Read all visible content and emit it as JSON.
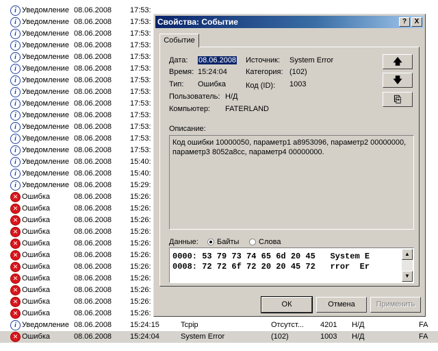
{
  "event_list": {
    "rows": [
      {
        "type": "Уведомление",
        "date": "08.06.2008",
        "time": "17:53:",
        "icon": "info-icon",
        "src": "",
        "cat": "",
        "evt": "",
        "usr": "",
        "comp": ""
      },
      {
        "type": "Уведомление",
        "date": "08.06.2008",
        "time": "17:53:",
        "icon": "info-icon",
        "src": "",
        "cat": "",
        "evt": "",
        "usr": "",
        "comp": ""
      },
      {
        "type": "Уведомление",
        "date": "08.06.2008",
        "time": "17:53:",
        "icon": "info-icon",
        "src": "",
        "cat": "",
        "evt": "",
        "usr": "",
        "comp": ""
      },
      {
        "type": "Уведомление",
        "date": "08.06.2008",
        "time": "17:53:",
        "icon": "info-icon",
        "src": "",
        "cat": "",
        "evt": "",
        "usr": "",
        "comp": ""
      },
      {
        "type": "Уведомление",
        "date": "08.06.2008",
        "time": "17:53:",
        "icon": "info-icon",
        "src": "",
        "cat": "",
        "evt": "",
        "usr": "",
        "comp": ""
      },
      {
        "type": "Уведомление",
        "date": "08.06.2008",
        "time": "17:53:",
        "icon": "info-icon",
        "src": "",
        "cat": "",
        "evt": "",
        "usr": "",
        "comp": ""
      },
      {
        "type": "Уведомление",
        "date": "08.06.2008",
        "time": "17:53:",
        "icon": "info-icon",
        "src": "",
        "cat": "",
        "evt": "",
        "usr": "",
        "comp": ""
      },
      {
        "type": "Уведомление",
        "date": "08.06.2008",
        "time": "17:53:",
        "icon": "info-icon",
        "src": "",
        "cat": "",
        "evt": "",
        "usr": "",
        "comp": ""
      },
      {
        "type": "Уведомление",
        "date": "08.06.2008",
        "time": "17:53:",
        "icon": "info-icon",
        "src": "",
        "cat": "",
        "evt": "",
        "usr": "",
        "comp": ""
      },
      {
        "type": "Уведомление",
        "date": "08.06.2008",
        "time": "17:53:",
        "icon": "info-icon",
        "src": "",
        "cat": "",
        "evt": "",
        "usr": "",
        "comp": ""
      },
      {
        "type": "Уведомление",
        "date": "08.06.2008",
        "time": "17:53:",
        "icon": "info-icon",
        "src": "",
        "cat": "",
        "evt": "",
        "usr": "",
        "comp": ""
      },
      {
        "type": "Уведомление",
        "date": "08.06.2008",
        "time": "17:53:",
        "icon": "info-icon",
        "src": "",
        "cat": "",
        "evt": "",
        "usr": "",
        "comp": ""
      },
      {
        "type": "Уведомление",
        "date": "08.06.2008",
        "time": "17:53:",
        "icon": "info-icon",
        "src": "",
        "cat": "",
        "evt": "",
        "usr": "",
        "comp": ""
      },
      {
        "type": "Уведомление",
        "date": "08.06.2008",
        "time": "15:40:",
        "icon": "info-icon",
        "src": "",
        "cat": "",
        "evt": "",
        "usr": "",
        "comp": ""
      },
      {
        "type": "Уведомление",
        "date": "08.06.2008",
        "time": "15:40:",
        "icon": "info-icon",
        "src": "",
        "cat": "",
        "evt": "",
        "usr": "",
        "comp": ""
      },
      {
        "type": "Уведомление",
        "date": "08.06.2008",
        "time": "15:29:",
        "icon": "info-icon",
        "src": "",
        "cat": "",
        "evt": "",
        "usr": "",
        "comp": ""
      },
      {
        "type": "Ошибка",
        "date": "08.06.2008",
        "time": "15:26:",
        "icon": "error-icon",
        "src": "",
        "cat": "",
        "evt": "",
        "usr": "",
        "comp": ""
      },
      {
        "type": "Ошибка",
        "date": "08.06.2008",
        "time": "15:26:",
        "icon": "error-icon",
        "src": "",
        "cat": "",
        "evt": "",
        "usr": "",
        "comp": ""
      },
      {
        "type": "Ошибка",
        "date": "08.06.2008",
        "time": "15:26:",
        "icon": "error-icon",
        "src": "",
        "cat": "",
        "evt": "",
        "usr": "",
        "comp": ""
      },
      {
        "type": "Ошибка",
        "date": "08.06.2008",
        "time": "15:26:",
        "icon": "error-icon",
        "src": "",
        "cat": "",
        "evt": "",
        "usr": "",
        "comp": ""
      },
      {
        "type": "Ошибка",
        "date": "08.06.2008",
        "time": "15:26:",
        "icon": "error-icon",
        "src": "",
        "cat": "",
        "evt": "",
        "usr": "",
        "comp": ""
      },
      {
        "type": "Ошибка",
        "date": "08.06.2008",
        "time": "15:26:",
        "icon": "error-icon",
        "src": "",
        "cat": "",
        "evt": "",
        "usr": "",
        "comp": ""
      },
      {
        "type": "Ошибка",
        "date": "08.06.2008",
        "time": "15:26:",
        "icon": "error-icon",
        "src": "",
        "cat": "",
        "evt": "",
        "usr": "",
        "comp": ""
      },
      {
        "type": "Ошибка",
        "date": "08.06.2008",
        "time": "15:26:",
        "icon": "error-icon",
        "src": "",
        "cat": "",
        "evt": "",
        "usr": "",
        "comp": ""
      },
      {
        "type": "Ошибка",
        "date": "08.06.2008",
        "time": "15:26:",
        "icon": "error-icon",
        "src": "",
        "cat": "",
        "evt": "",
        "usr": "",
        "comp": ""
      },
      {
        "type": "Ошибка",
        "date": "08.06.2008",
        "time": "15:26:",
        "icon": "error-icon",
        "src": "",
        "cat": "",
        "evt": "",
        "usr": "",
        "comp": ""
      },
      {
        "type": "Ошибка",
        "date": "08.06.2008",
        "time": "15:26:",
        "icon": "error-icon",
        "src": "",
        "cat": "",
        "evt": "",
        "usr": "",
        "comp": ""
      },
      {
        "type": "Уведомление",
        "date": "08.06.2008",
        "time": "15:24:15",
        "icon": "info-icon",
        "src": "Tcpip",
        "cat": "Отсутст...",
        "evt": "4201",
        "usr": "Н/Д",
        "comp": "FA"
      },
      {
        "type": "Ошибка",
        "date": "08.06.2008",
        "time": "15:24:04",
        "icon": "error-icon",
        "src": "System Error",
        "cat": "(102)",
        "evt": "1003",
        "usr": "Н/Д",
        "comp": "FA",
        "selected": true
      }
    ]
  },
  "dialog": {
    "title": "Свойства: Событие",
    "help_label": "?",
    "close_label": "X",
    "tab_label": "Событие",
    "date_label": "Дата:",
    "date_value": "08.06.2008",
    "time_label": "Время:",
    "time_value": "15:24:04",
    "type_label": "Тип:",
    "type_value": "Ошибка",
    "user_label": "Пользователь:",
    "user_value": "Н/Д",
    "computer_label": "Компьютер:",
    "computer_value": "FATERLAND",
    "source_label": "Источник:",
    "source_value": "System Error",
    "category_label": "Категория:",
    "category_value": "(102)",
    "eventid_label": "Код (ID):",
    "eventid_value": "1003",
    "up_glyph": "🡅",
    "down_glyph": "🡇",
    "copy_glyph": "⎘",
    "description_label": "Описание:",
    "description": "Код ошибки 10000050, параметр1 a8953096, параметр2 00000000,\nпараметр3 8052a8cc, параметр4 00000000.",
    "data_label": "Данные:",
    "bytes_label": "Байты",
    "words_label": "Слова",
    "hex_line1": "0000: 53 79 73 74 65 6d 20 45   System E",
    "hex_line2": "0008: 72 72 6f 72 20 20 45 72   rror  Er",
    "ok_label": "ОК",
    "cancel_label": "Отмена",
    "apply_label": "Применить"
  }
}
